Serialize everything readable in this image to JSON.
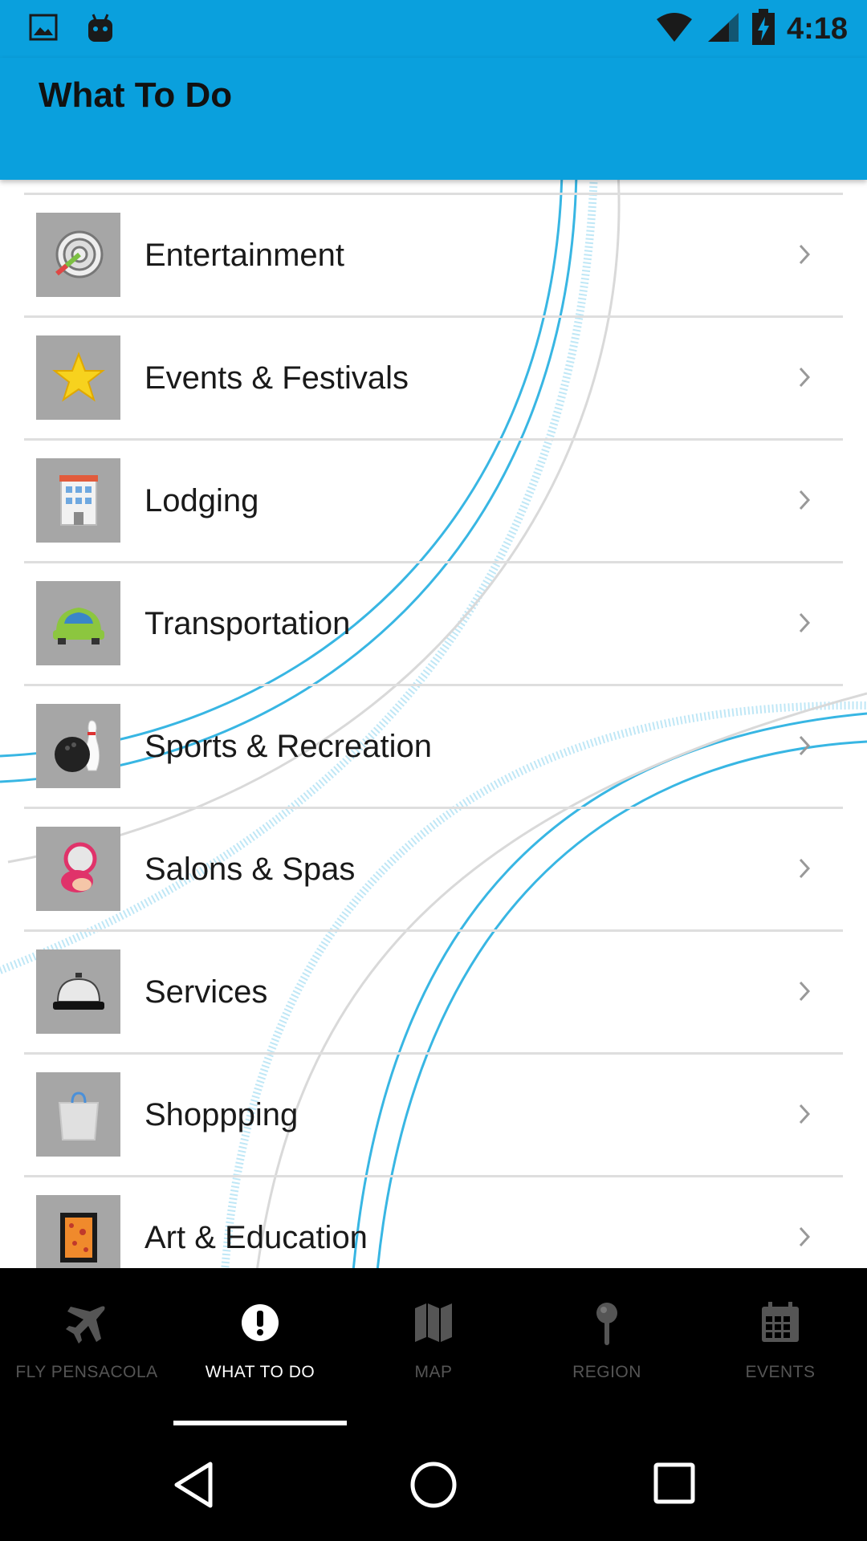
{
  "status_bar": {
    "time": "4:18",
    "icons": [
      "image-icon",
      "android-icon",
      "wifi-icon",
      "signal-icon",
      "battery-charging-icon"
    ]
  },
  "app_bar": {
    "title": "What To Do"
  },
  "list": {
    "items": [
      {
        "label": "Entertainment",
        "icon": "dart-target-icon"
      },
      {
        "label": "Events & Festivals",
        "icon": "star-icon"
      },
      {
        "label": "Lodging",
        "icon": "hotel-icon"
      },
      {
        "label": "Transportation",
        "icon": "car-icon"
      },
      {
        "label": "Sports & Recreation",
        "icon": "bowling-icon"
      },
      {
        "label": "Salons & Spas",
        "icon": "compact-mirror-icon"
      },
      {
        "label": "Services",
        "icon": "service-bell-icon"
      },
      {
        "label": "Shoppping",
        "icon": "shopping-bag-icon"
      },
      {
        "label": "Art & Education",
        "icon": "framed-art-icon"
      }
    ]
  },
  "bottom_nav": {
    "items": [
      {
        "label": "FLY PENSACOLA",
        "icon": "airplane-icon",
        "active": false
      },
      {
        "label": "WHAT TO DO",
        "icon": "exclamation-icon",
        "active": true
      },
      {
        "label": "MAP",
        "icon": "map-icon",
        "active": false
      },
      {
        "label": "REGION",
        "icon": "pin-icon",
        "active": false
      },
      {
        "label": "EVENTS",
        "icon": "calendar-icon",
        "active": false
      }
    ]
  },
  "colors": {
    "app_bar": "#0aa0dd",
    "nav_background": "#000000",
    "nav_inactive": "#555555",
    "nav_active": "#ffffff",
    "thumb_background": "#a6a6a6"
  }
}
